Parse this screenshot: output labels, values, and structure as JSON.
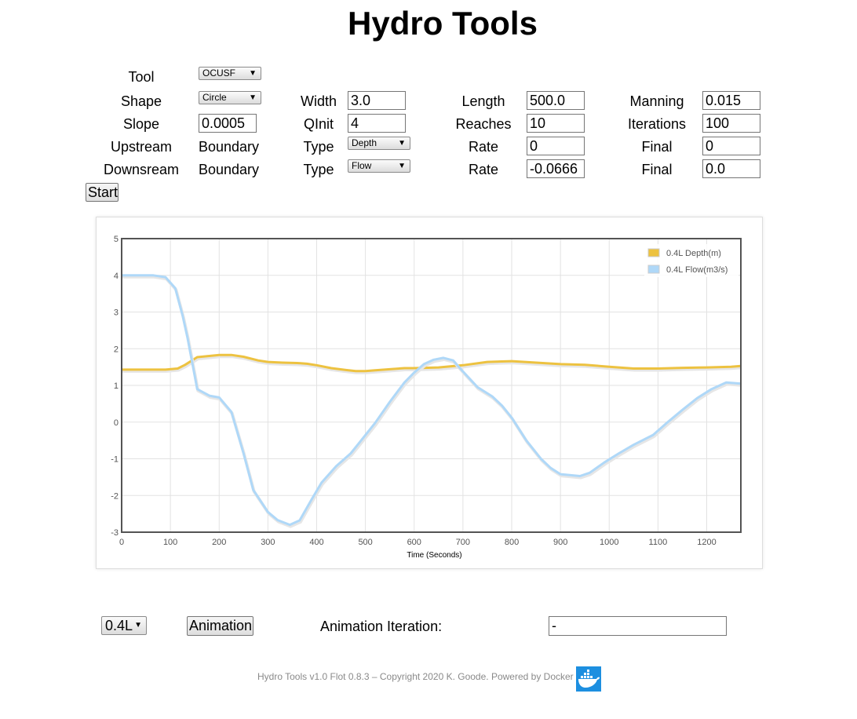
{
  "page": {
    "title": "Hydro Tools"
  },
  "form": {
    "tool_label": "Tool",
    "tool_value": "OCUSF",
    "shape_label": "Shape",
    "shape_value": "Circle",
    "slope_label": "Slope",
    "slope_value": "0.0005",
    "upstream_label": "Upstream",
    "upstream_boundary": "Boundary",
    "downstream_label": "Downsream",
    "downstream_boundary": "Boundary",
    "width_label": "Width",
    "width_value": "3.0",
    "qinit_label": "QInit",
    "qinit_value": "4",
    "up_type_label": "Type",
    "up_type_value": "Depth",
    "down_type_label": "Type",
    "down_type_value": "Flow",
    "length_label": "Length",
    "length_value": "500.0",
    "reaches_label": "Reaches",
    "reaches_value": "10",
    "up_rate_label": "Rate",
    "up_rate_value": "0",
    "down_rate_label": "Rate",
    "down_rate_value": "-0.0666",
    "manning_label": "Manning",
    "manning_value": "0.015",
    "iterations_label": "Iterations",
    "iterations_value": "100",
    "up_final_label": "Final",
    "up_final_value": "0",
    "down_final_label": "Final",
    "down_final_value": "0.0",
    "start_label": "Start"
  },
  "controls": {
    "location_value": "0.4L",
    "animation_label": "Animation",
    "iteration_label": "Animation Iteration:",
    "iteration_value": "-"
  },
  "footer": {
    "text": "Hydro Tools v1.0 Flot 0.8.3 – Copyright 2020 K. Goode. Powered by Docker",
    "logo_icon": "docker-whale-icon"
  },
  "chart_data": {
    "type": "line",
    "xlabel": "Time (Seconds)",
    "ylabel": "",
    "xlim": [
      0,
      1270
    ],
    "ylim": [
      -3,
      5
    ],
    "x_ticks": [
      0,
      100,
      200,
      300,
      400,
      500,
      600,
      700,
      800,
      900,
      1000,
      1100,
      1200
    ],
    "y_ticks": [
      5,
      4,
      3,
      2,
      1,
      0,
      -1,
      -2,
      -3
    ],
    "grid": true,
    "legend_position": "top-right",
    "series": [
      {
        "name": "0.4L Depth(m)",
        "color": "#edc240",
        "x": [
          0,
          50,
          90,
          115,
          130,
          155,
          200,
          225,
          250,
          280,
          300,
          330,
          360,
          380,
          400,
          430,
          460,
          480,
          500,
          520,
          550,
          580,
          600,
          650,
          700,
          750,
          800,
          850,
          900,
          950,
          1000,
          1050,
          1100,
          1150,
          1200,
          1250,
          1270
        ],
        "values": [
          1.43,
          1.43,
          1.43,
          1.46,
          1.56,
          1.77,
          1.83,
          1.83,
          1.78,
          1.68,
          1.64,
          1.62,
          1.61,
          1.59,
          1.55,
          1.47,
          1.42,
          1.39,
          1.39,
          1.41,
          1.44,
          1.47,
          1.47,
          1.49,
          1.55,
          1.64,
          1.66,
          1.62,
          1.58,
          1.56,
          1.51,
          1.46,
          1.46,
          1.48,
          1.49,
          1.51,
          1.53
        ]
      },
      {
        "name": "0.4L Flow(m3/s)",
        "color": "#afd8f8",
        "x": [
          0,
          30,
          65,
          90,
          110,
          125,
          135,
          155,
          180,
          200,
          225,
          250,
          270,
          300,
          320,
          345,
          365,
          390,
          410,
          440,
          470,
          490,
          520,
          550,
          580,
          600,
          620,
          640,
          660,
          680,
          700,
          730,
          760,
          780,
          800,
          830,
          860,
          880,
          900,
          940,
          960,
          990,
          1020,
          1050,
          1090,
          1120,
          1150,
          1180,
          1210,
          1240,
          1270
        ],
        "values": [
          4.0,
          4.0,
          4.0,
          3.95,
          3.65,
          2.9,
          2.3,
          0.9,
          0.72,
          0.67,
          0.28,
          -0.85,
          -1.85,
          -2.45,
          -2.67,
          -2.8,
          -2.68,
          -2.1,
          -1.65,
          -1.2,
          -0.85,
          -0.52,
          -0.02,
          0.55,
          1.08,
          1.35,
          1.58,
          1.7,
          1.75,
          1.68,
          1.38,
          0.95,
          0.7,
          0.45,
          0.12,
          -0.5,
          -1.0,
          -1.25,
          -1.42,
          -1.47,
          -1.38,
          -1.1,
          -0.85,
          -0.62,
          -0.35,
          0.0,
          0.33,
          0.65,
          0.9,
          1.08,
          1.05
        ]
      }
    ]
  }
}
